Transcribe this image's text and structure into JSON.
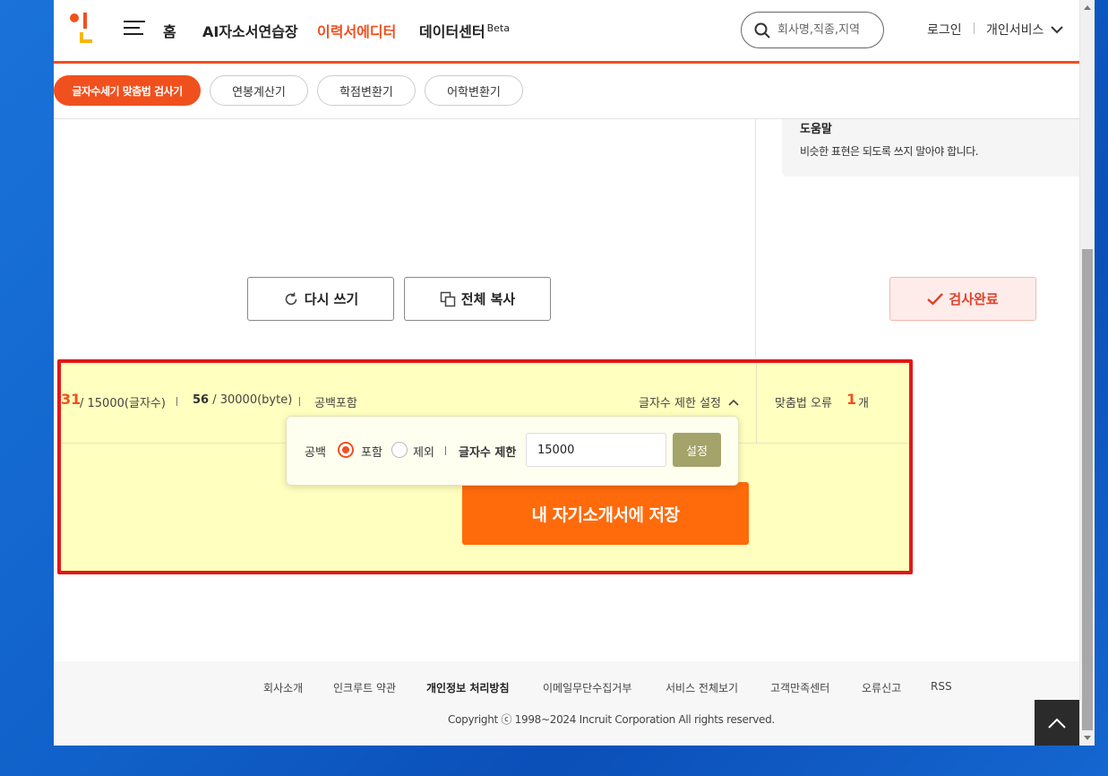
{
  "header": {
    "logo_icon": "incruit-logo-icon",
    "nav": [
      "홈",
      "AI자소서연습장",
      "이력서에디터",
      "데이터센터"
    ],
    "nav_badge": "Beta",
    "active_nav": "이력서에디터",
    "search_placeholder": "회사명,직종,지역",
    "login": "로그인",
    "personal_services": "개인서비스",
    "accent_color": "#f0501e"
  },
  "tools": [
    "글자수세기 맞춤법 검사기",
    "연봉계산기",
    "학점변환기",
    "어학변환기"
  ],
  "editor": {
    "rewrite_label": "다시 쓰기",
    "copy_all_label": "전체 복사"
  },
  "side": {
    "help_title": "도움말",
    "help_text": "비슷한 표현은 되도록 쓰지 말아야 합니다.",
    "done_label": "검사완료"
  },
  "status": {
    "char_count": "31",
    "char_limit_text": "/ 15000(글자수)",
    "byte_count": "56",
    "byte_limit_text": "/ 30000(byte)",
    "space_mode": "공백포함",
    "limit_setting_label": "글자수 제한 설정",
    "spelling_error_label": "맞춤법 오류",
    "spelling_error_count": "1",
    "spelling_error_unit": "개"
  },
  "limit_popup": {
    "space_label": "공백",
    "option_include": "포함",
    "option_exclude": "제외",
    "selected_option": "포함",
    "limit_label": "글자수 제한",
    "limit_value": "15000",
    "set_label": "설정"
  },
  "save_label": "내 자기소개서에 저장",
  "footer": {
    "links": [
      "회사소개",
      "인크루트 약관",
      "개인정보 처리방침",
      "이메일무단수집거부",
      "서비스 전체보기",
      "고객만족센터",
      "오류신고",
      "RSS"
    ],
    "copyright": "Copyright ⓒ 1998~2024 Incruit Corporation All rights reserved."
  }
}
